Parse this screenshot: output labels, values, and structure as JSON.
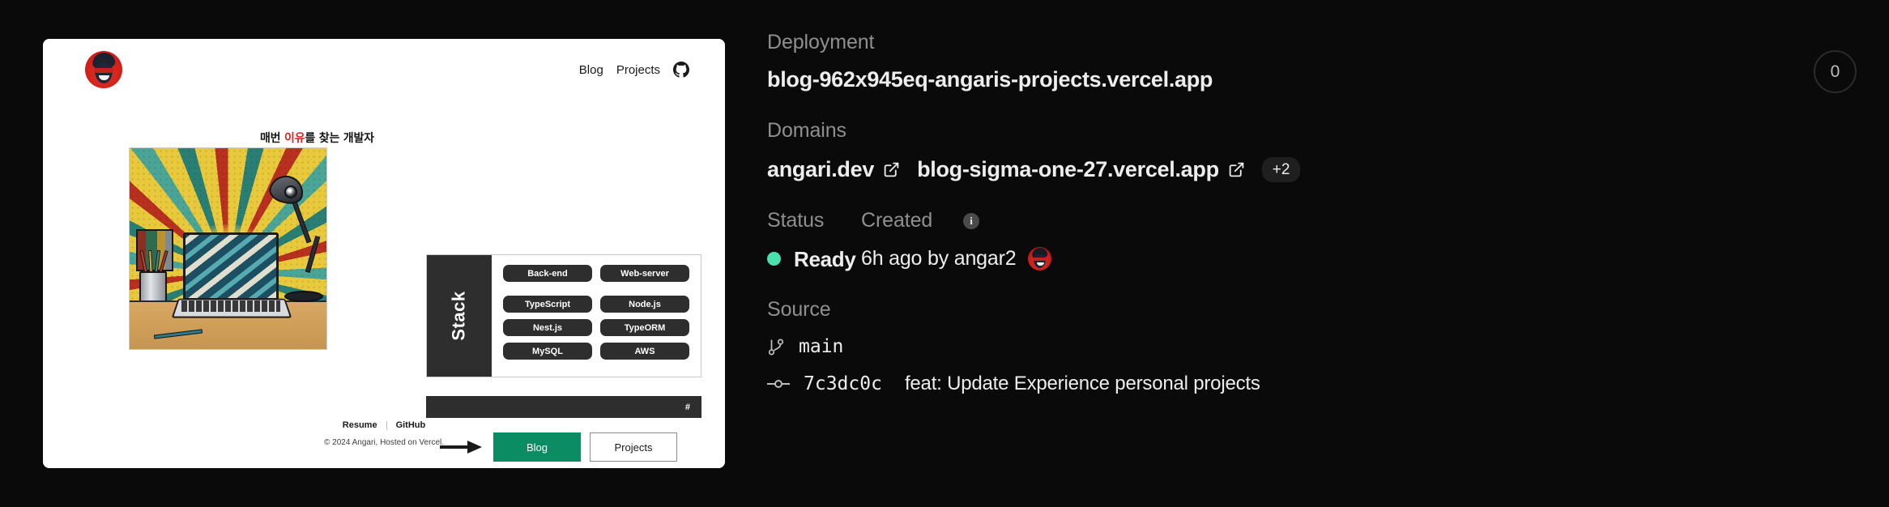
{
  "counter": {
    "value": "0"
  },
  "deployment": {
    "label": "Deployment",
    "url": "blog-962x945eq-angaris-projects.vercel.app"
  },
  "domains": {
    "label": "Domains",
    "items": [
      {
        "name": "angari.dev",
        "icon": "external-link-icon"
      },
      {
        "name": "blog-sigma-one-27.vercel.app",
        "icon": "external-link-icon"
      }
    ],
    "more_badge": "+2"
  },
  "status": {
    "label": "Status",
    "value": "Ready",
    "dot_color": "#4ae0b0",
    "created_label": "Created",
    "created_info_icon": "i",
    "created_value": "6h ago by angar2",
    "author_avatar": "avatar"
  },
  "source": {
    "label": "Source",
    "branch_icon": "git-branch-icon",
    "branch": "main",
    "commit_icon": "git-commit-icon",
    "commit_hash": "7c3dc0c",
    "commit_message": "feat: Update Experience personal projects"
  },
  "preview": {
    "nav": {
      "blog": "Blog",
      "projects": "Projects",
      "github_icon": "github-icon"
    },
    "headline": {
      "before": "매번 ",
      "accent": "이유",
      "after": "를 찾는 개발자"
    },
    "stack": {
      "title": "Stack",
      "col_left": [
        "Back-end",
        "TypeScript",
        "Nest.js",
        "MySQL"
      ],
      "col_right": [
        "Web-server",
        "Node.js",
        "TypeORM",
        "AWS"
      ]
    },
    "hash_bar": "#",
    "cta": {
      "primary": "Blog",
      "secondary": "Projects"
    },
    "footer": {
      "resume": "Resume",
      "github": "GitHub",
      "copyright": "© 2024 Angari, Hosted on Vercel."
    }
  }
}
